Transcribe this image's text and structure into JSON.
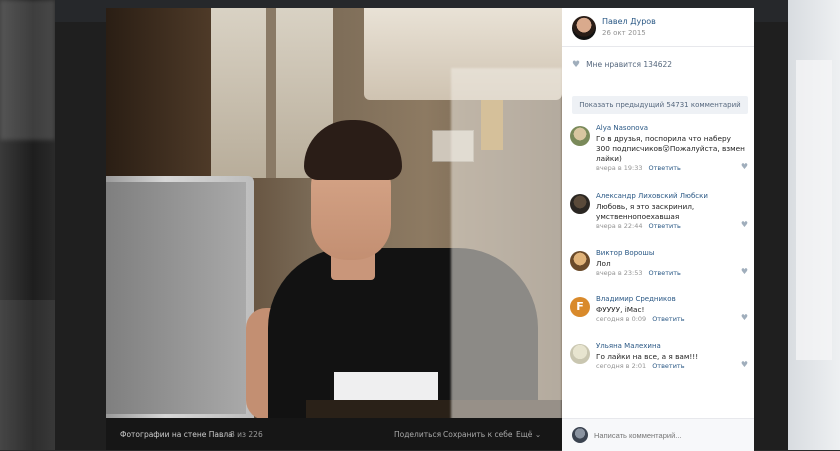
{
  "post": {
    "author": "Павел Дуров",
    "date": "26 окт 2015",
    "likes_label": "Мне нравится",
    "likes_count": "134622",
    "show_prev": "Показать предыдущий 54731 комментарий"
  },
  "comments": [
    {
      "author": "Alya Nasonova",
      "text": "Го в друзья, поспорила что наберу 300 подписчиков😮Пожалуйста, взмен лайки)",
      "time": "вчера в 19:33",
      "reply": "Ответить"
    },
    {
      "author": "Александр Лиховский Любски",
      "text": "Любовь, я это заскринил, умственнопоехавшая",
      "time": "вчера в 22:44",
      "reply": "Ответить"
    },
    {
      "author": "Виктор Ворошы",
      "text": "Лол",
      "time": "вчера в 23:53",
      "reply": "Ответить"
    },
    {
      "author": "Владимир Средников",
      "text": "ФУУУУ, iMac!",
      "time": "сегодня в 0:09",
      "reply": "Ответить"
    },
    {
      "author": "Ульяна Малехина",
      "text": "Го лайки на все, а я вам!!!",
      "time": "сегодня в 2:01",
      "reply": "Ответить"
    }
  ],
  "composer": {
    "placeholder": "Написать комментарий..."
  },
  "caption": {
    "title": "Фотографии на стене Павла",
    "count": "8 из 226",
    "share": "Поделиться",
    "save": "Сохранить к себе",
    "more": "Ещё"
  },
  "icons": {
    "like": "heart-icon",
    "more": "chevron-down-icon"
  },
  "colors": {
    "link": "#2a5885",
    "meta": "#939393",
    "panel_bg": "#ffffff",
    "viewer_bg": "#1f1f1f"
  }
}
